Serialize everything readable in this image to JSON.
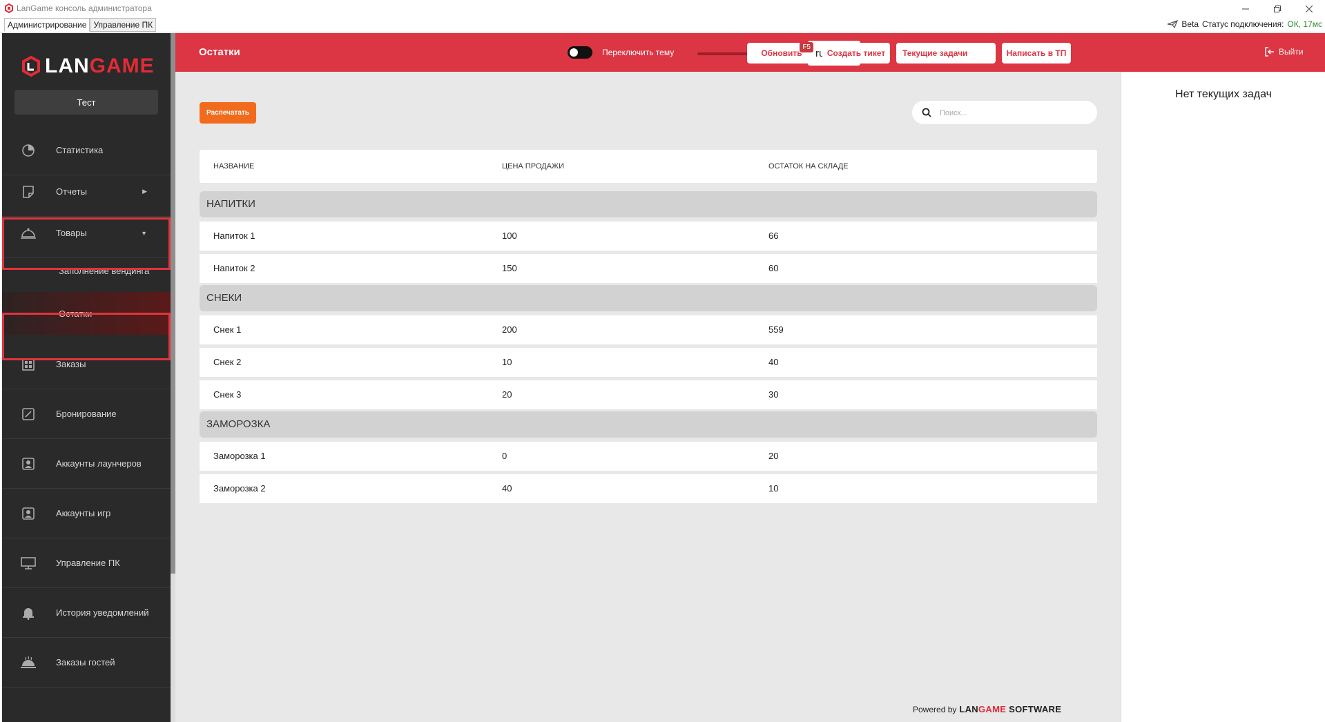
{
  "window": {
    "title": "LanGame консоль администратора"
  },
  "app_tabs": [
    {
      "label": "Администрирование"
    },
    {
      "label": "Управление ПК"
    }
  ],
  "connection": {
    "beta": "Beta",
    "status_label": "Статус подключения:",
    "status_value": "ОК, 17мс"
  },
  "logo": {
    "part1": "LAN",
    "part2": "GAME"
  },
  "club": {
    "name": "Тест"
  },
  "sidebar": {
    "items": [
      {
        "label": "Статистика",
        "icon": "pie-chart-icon"
      },
      {
        "label": "Отчеты",
        "icon": "report-icon"
      },
      {
        "label": "Товары",
        "icon": "service-bell-icon"
      },
      {
        "label": "Заполнение вендинга"
      },
      {
        "label": "Остатки"
      },
      {
        "label": "Заказы",
        "icon": "grid-icon"
      },
      {
        "label": "Бронирование",
        "icon": "edit-icon"
      },
      {
        "label": "Аккаунты лаунчеров",
        "icon": "account-icon"
      },
      {
        "label": "Аккаунты игр",
        "icon": "account-icon"
      },
      {
        "label": "Управление ПК",
        "icon": "monitor-icon"
      },
      {
        "label": "История уведомлений",
        "icon": "bell-icon"
      },
      {
        "label": "Заказы гостей",
        "icon": "cloche-icon"
      }
    ]
  },
  "header": {
    "title": "Остатки",
    "theme_toggle_label": "Переключить тему",
    "language": "ru",
    "refresh_label": "Обновить",
    "refresh_hotkey": "F5",
    "create_ticket_label": "Создать тикет",
    "current_tasks_label": "Текущие задачи",
    "support_label": "Написать в ТП",
    "logout_label": "Выйти"
  },
  "toolbar": {
    "print_label": "Распечатать",
    "search_placeholder": "Поиск..."
  },
  "table": {
    "columns": [
      "НАЗВАНИЕ",
      "ЦЕНА ПРОДАЖИ",
      "ОСТАТОК НА СКЛАДЕ"
    ],
    "groups": [
      {
        "name": "НАПИТКИ",
        "rows": [
          [
            "Напиток 1",
            "100",
            "66"
          ],
          [
            "Напиток 2",
            "150",
            "60"
          ]
        ]
      },
      {
        "name": "СНЕКИ",
        "rows": [
          [
            "Снек 1",
            "200",
            "559"
          ],
          [
            "Снек 2",
            "10",
            "40"
          ],
          [
            "Снек 3",
            "20",
            "30"
          ]
        ]
      },
      {
        "name": "ЗАМОРОЗКА",
        "rows": [
          [
            "Заморозка 1",
            "0",
            "20"
          ],
          [
            "Заморозка 2",
            "40",
            "10"
          ]
        ]
      }
    ]
  },
  "footer": {
    "powered_by": "Powered by",
    "brand_lan": "LAN",
    "brand_game": "GAME",
    "brand_software": " SOFTWARE"
  },
  "tasks_panel": {
    "empty_text": "Нет текущих задач"
  },
  "colors": {
    "accent": "#dc3543",
    "print_button": "#f26b1d",
    "sidebar_bg": "#2a2a2a",
    "ok_status": "#2e8b2e"
  }
}
